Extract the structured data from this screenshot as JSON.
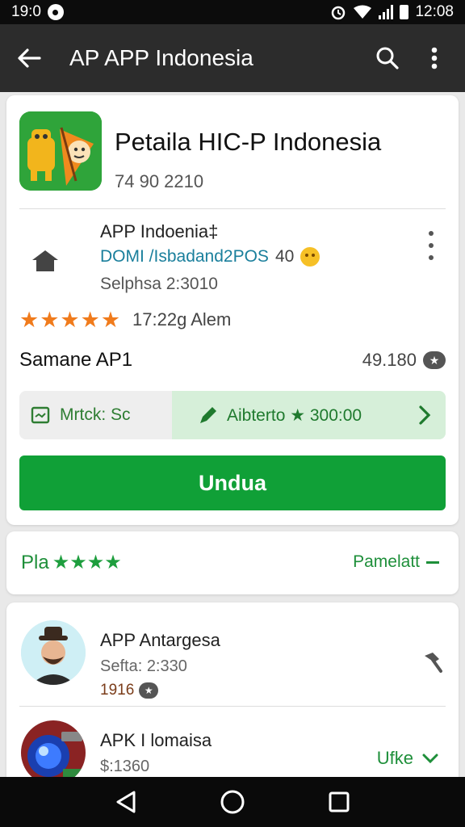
{
  "status_bar": {
    "time_left": "19:0",
    "time_right": "12:08",
    "icons": [
      "alarm-icon",
      "wifi-icon",
      "signal-icon",
      "battery-icon"
    ]
  },
  "app_bar": {
    "title": "AP APP Indonesia",
    "icons": [
      "back-arrow-icon",
      "search-icon",
      "more-vert-icon"
    ]
  },
  "app": {
    "title": "Petaila HIC-P Indonesia",
    "subtitle": "74 90 2210",
    "developer": "APP Indoenia‡",
    "developer_link": "DOMI /Isbadand2POS",
    "version": "40",
    "updated": "Selphsa 2:3010",
    "rating_stars": 5,
    "rating_text": "17:22g Alem",
    "samp_label": "Samane AP1",
    "samp_value": "49.180",
    "seg_left": "Mrtck: Sc",
    "seg_right": "Aibterto ★ 300:00",
    "install_label": "Undua"
  },
  "ratings_card": {
    "left_label": "Pla",
    "left_stars": "★★★★",
    "right_label": "Pamelatt"
  },
  "reviews": [
    {
      "name": "APP Antargesa",
      "date": "Sefta: 2:330",
      "meta": "1916"
    },
    {
      "name": "APK I lomaisa",
      "date": "$:1360",
      "action": "Ufke"
    }
  ],
  "colors": {
    "accent": "#10a037",
    "app_bar": "#2c2c2c",
    "star_orange": "#f07b1c"
  }
}
